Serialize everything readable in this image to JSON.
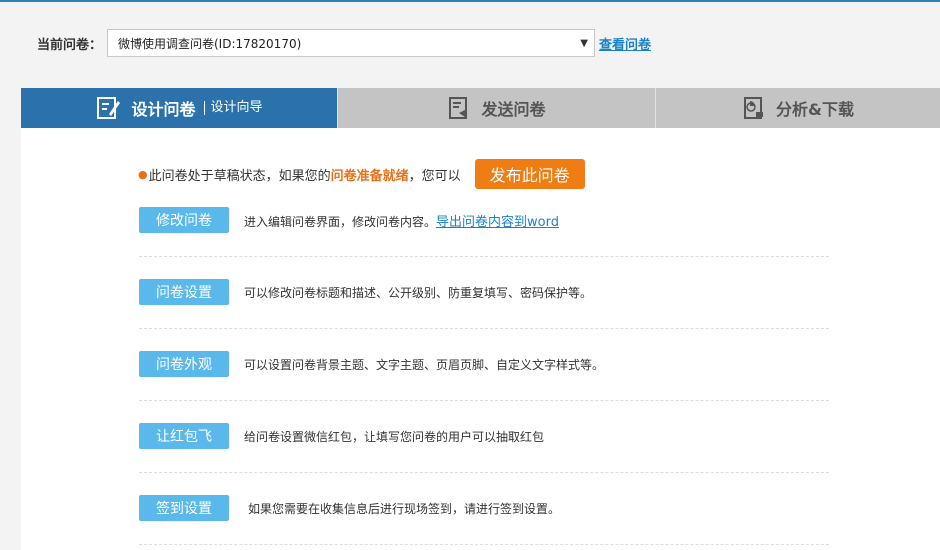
{
  "header": {
    "current_label": "当前问卷：",
    "selected_survey": "微博使用调查问卷(ID:17820170)",
    "view_link": "查看问卷"
  },
  "tabs": [
    {
      "label": "设计问卷",
      "sub": "设计向导",
      "icon": "edit-doc-icon",
      "active": true
    },
    {
      "label": "发送问卷",
      "icon": "send-doc-icon",
      "active": false
    },
    {
      "label": "分析&下载",
      "icon": "analysis-doc-icon",
      "active": false
    }
  ],
  "status": {
    "prefix": "此问卷处于草稿状态，如果您的",
    "highlight": "问卷准备就绪",
    "suffix": "，您可以",
    "publish_label": "发布此问卷"
  },
  "actions": [
    {
      "label": "修改问卷",
      "desc": "进入编辑问卷界面，修改问卷内容。",
      "link": "导出问卷内容到word"
    },
    {
      "label": "问卷设置",
      "desc": "可以修改问卷标题和描述、公开级别、防重复填写、密码保护等。"
    },
    {
      "label": "问卷外观",
      "desc": "可以设置问卷背景主题、文字主题、页眉页脚、自定义文字样式等。"
    },
    {
      "label": "让红包飞",
      "desc": "给问卷设置微信红包，让填写您问卷的用户可以抽取红包"
    },
    {
      "label": "签到设置",
      "desc": "如果您需要在收集信息后进行现场签到，请进行签到设置。"
    }
  ],
  "colors": {
    "active_tab": "#2b72ad",
    "inactive_tab": "#c4c4c4",
    "publish_button": "#f07c14",
    "action_button": "#5ab8ea",
    "link": "#1a82c9"
  }
}
